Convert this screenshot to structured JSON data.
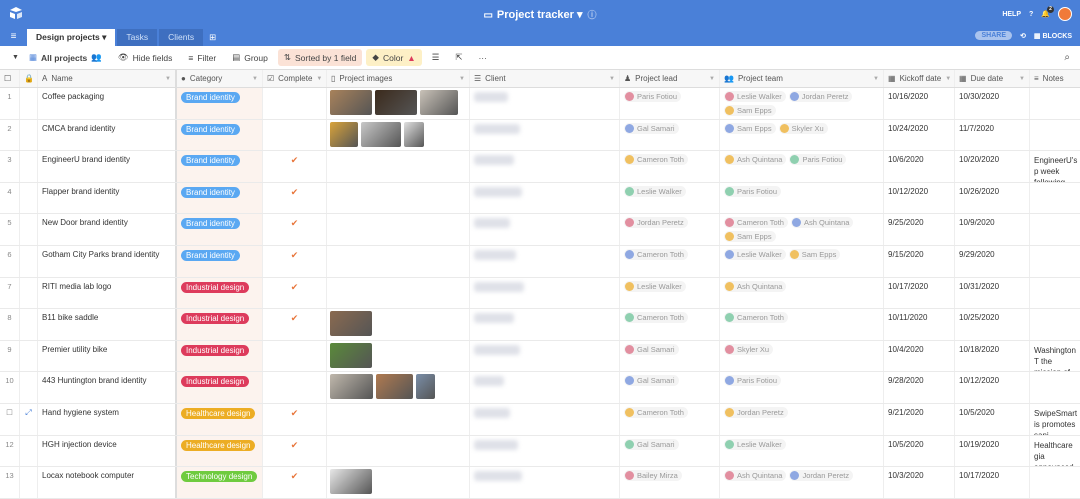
{
  "app": {
    "title": "Project tracker",
    "help": "HELP",
    "notifications": "2",
    "share": "SHARE",
    "blocks": "BLOCKS",
    "brand_color": "#4a80d8"
  },
  "tabs": [
    {
      "label": "Design projects ▾",
      "active": true
    },
    {
      "label": "Tasks"
    },
    {
      "label": "Clients"
    }
  ],
  "toolbar": {
    "view": "All projects",
    "hide_fields": "Hide fields",
    "filter": "Filter",
    "group": "Group",
    "sorted": "Sorted by 1 field",
    "color": "Color"
  },
  "columns": [
    "Name",
    "Category",
    "Complete",
    "Project images",
    "Client",
    "Project lead",
    "Project team",
    "Kickoff date",
    "Due date",
    "Notes"
  ],
  "category_colors": {
    "Brand identity": "#5aa8f2",
    "Industrial design": "#dd3b5c",
    "Healthcare design": "#ecad24",
    "Technology design": "#6fcb3f"
  },
  "rows": [
    {
      "n": "1",
      "name": "Coffee packaging",
      "category": "Brand identity",
      "complete": false,
      "images": 3,
      "lead": "Paris Fotiou",
      "team": [
        "Leslie Walker",
        "Jordan Peretz",
        "Sam Epps"
      ],
      "kickoff": "10/16/2020",
      "due": "10/30/2020",
      "notes": ""
    },
    {
      "n": "2",
      "name": "CMCA brand identity",
      "category": "Brand identity",
      "complete": false,
      "images": 3,
      "lead": "Gal Samari",
      "team": [
        "Sam Epps",
        "Skyler Xu"
      ],
      "kickoff": "10/24/2020",
      "due": "11/7/2020",
      "notes": ""
    },
    {
      "n": "3",
      "name": "EngineerU brand identity",
      "category": "Brand identity",
      "complete": true,
      "images": 0,
      "lead": "Cameron Toth",
      "team": [
        "Ash Quintana",
        "Paris Fotiou"
      ],
      "kickoff": "10/6/2020",
      "due": "10/20/2020",
      "notes": "EngineerU's p week following"
    },
    {
      "n": "4",
      "name": "Flapper brand identity",
      "category": "Brand identity",
      "complete": true,
      "images": 0,
      "lead": "Leslie Walker",
      "team": [
        "Paris Fotiou"
      ],
      "kickoff": "10/12/2020",
      "due": "10/26/2020",
      "notes": ""
    },
    {
      "n": "5",
      "name": "New Door brand identity",
      "category": "Brand identity",
      "complete": true,
      "images": 0,
      "lead": "Jordan Peretz",
      "team": [
        "Cameron Toth",
        "Ash Quintana",
        "Sam Epps"
      ],
      "kickoff": "9/25/2020",
      "due": "10/9/2020",
      "notes": ""
    },
    {
      "n": "6",
      "name": "Gotham City Parks brand identity",
      "category": "Brand identity",
      "complete": true,
      "images": 0,
      "lead": "Cameron Toth",
      "team": [
        "Leslie Walker",
        "Sam Epps"
      ],
      "kickoff": "9/15/2020",
      "due": "9/29/2020",
      "notes": ""
    },
    {
      "n": "7",
      "name": "RITI media lab logo",
      "category": "Industrial design",
      "complete": true,
      "images": 0,
      "lead": "Leslie Walker",
      "team": [
        "Ash Quintana"
      ],
      "kickoff": "10/17/2020",
      "due": "10/31/2020",
      "notes": ""
    },
    {
      "n": "8",
      "name": "B11 bike saddle",
      "category": "Industrial design",
      "complete": true,
      "images": 1,
      "lead": "Cameron Toth",
      "team": [
        "Cameron Toth"
      ],
      "kickoff": "10/11/2020",
      "due": "10/25/2020",
      "notes": ""
    },
    {
      "n": "9",
      "name": "Premier utility bike",
      "category": "Industrial design",
      "complete": false,
      "images": 1,
      "lead": "Gal Samari",
      "team": [
        "Skyler Xu"
      ],
      "kickoff": "10/4/2020",
      "due": "10/18/2020",
      "notes": "Washington T the mission of"
    },
    {
      "n": "10",
      "name": "443 Huntington brand identity",
      "category": "Industrial design",
      "complete": false,
      "images": 3,
      "lead": "Gal Samari",
      "team": [
        "Paris Fotiou"
      ],
      "kickoff": "9/28/2020",
      "due": "10/12/2020",
      "notes": ""
    },
    {
      "n": "",
      "hover": true,
      "name": "Hand hygiene system",
      "category": "Healthcare design",
      "complete": true,
      "images": 0,
      "lead": "Cameron Toth",
      "team": [
        "Jordan Peretz"
      ],
      "kickoff": "9/21/2020",
      "due": "10/5/2020",
      "notes": "SwipeSmart is promotes sani"
    },
    {
      "n": "12",
      "name": "HGH injection device",
      "category": "Healthcare design",
      "complete": true,
      "images": 0,
      "lead": "Gal Samari",
      "team": [
        "Leslie Walker"
      ],
      "kickoff": "10/5/2020",
      "due": "10/19/2020",
      "notes": "Healthcare gia announced pla"
    },
    {
      "n": "13",
      "name": "Locax notebook computer",
      "category": "Technology design",
      "complete": true,
      "images": 1,
      "lead": "Bailey Mirza",
      "team": [
        "Ash Quintana",
        "Jordan Peretz"
      ],
      "kickoff": "10/3/2020",
      "due": "10/17/2020",
      "notes": ""
    }
  ]
}
